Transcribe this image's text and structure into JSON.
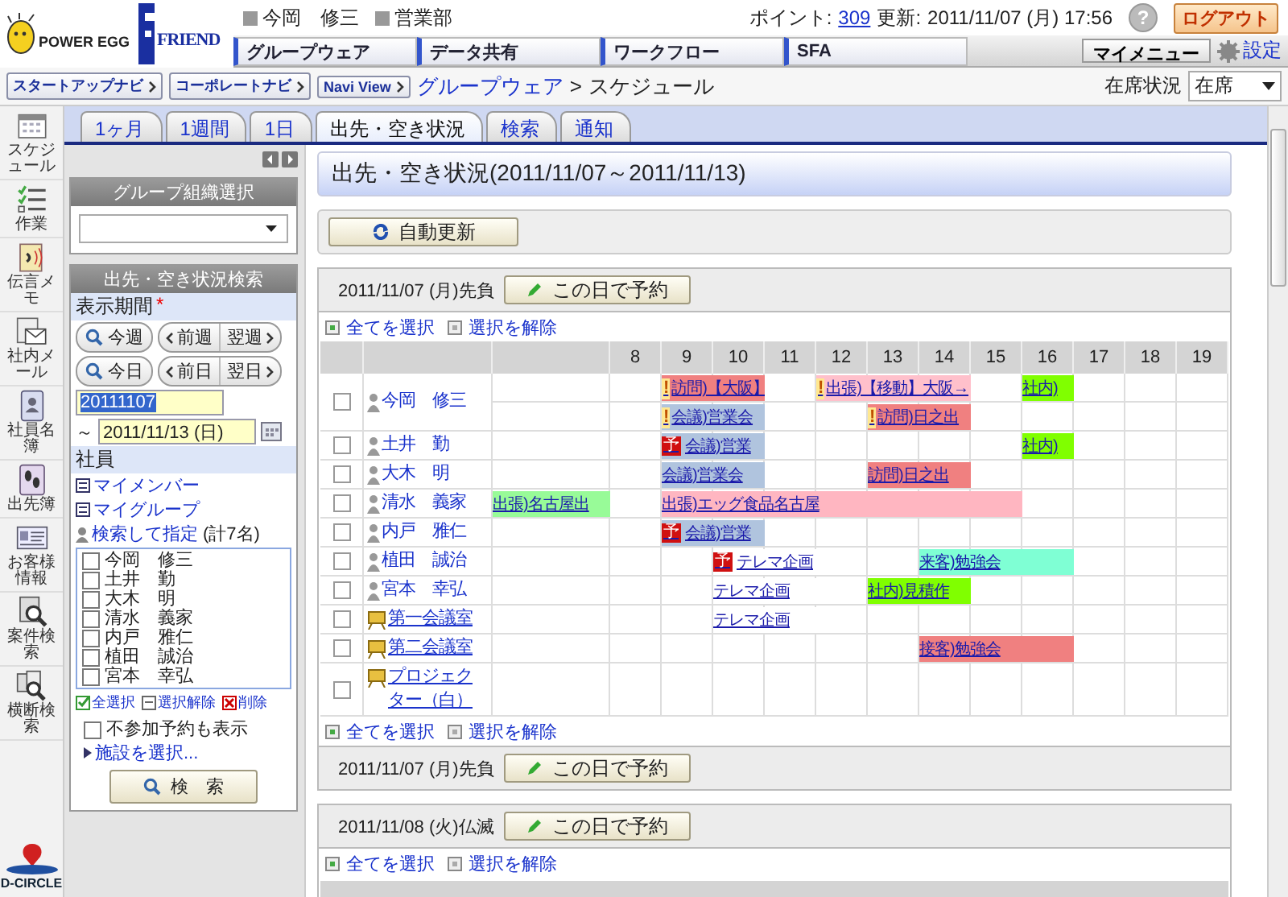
{
  "header": {
    "logo": {
      "product": "POWER EGG",
      "edition": "FRIEND"
    },
    "user": {
      "name": "今岡　修三",
      "department": "営業部"
    },
    "points_label": "ポイント:",
    "points": "309",
    "updated_label": "更新:",
    "updated": "2011/11/07 (月) 17:56",
    "help": "?",
    "logout": "ログアウト",
    "nav": [
      "グループウェア",
      "データ共有",
      "ワークフロー",
      "SFA"
    ],
    "my_menu": "マイメニュー",
    "settings": "設定"
  },
  "navi_buttons": [
    "スタートアップナビ",
    "コーポレートナビ",
    "Navi View"
  ],
  "breadcrumb": [
    "グループウェア",
    "スケジュール"
  ],
  "breadcrumb_separator": ">",
  "presence": {
    "label": "在席状況",
    "value": "在席"
  },
  "sidebar": [
    {
      "label": "スケジュール",
      "kind": "calendar"
    },
    {
      "label": "作業",
      "kind": "checklist"
    },
    {
      "label": "伝言メモ",
      "kind": "memo"
    },
    {
      "label": "社内メール",
      "kind": "mail"
    },
    {
      "label": "社員名簿",
      "kind": "contacts"
    },
    {
      "label": "出先簿",
      "kind": "footprints"
    },
    {
      "label": "お客様情報",
      "kind": "customer"
    },
    {
      "label": "案件検索",
      "kind": "search"
    },
    {
      "label": "横断検索",
      "kind": "multisearch"
    }
  ],
  "footer_logo": "D-CIRCLE",
  "tabs": [
    {
      "label": "1ヶ月",
      "selected": false
    },
    {
      "label": "1週間",
      "selected": false
    },
    {
      "label": "1日",
      "selected": false
    },
    {
      "label": "出先・空き状況",
      "selected": true
    },
    {
      "label": "検索",
      "selected": false
    },
    {
      "label": "通知",
      "selected": false
    }
  ],
  "group_select": {
    "title": "グループ組織選択"
  },
  "search_panel": {
    "title": "出先・空き状況検索",
    "period_label": "表示期間",
    "required_mark": "*",
    "week_buttons": [
      {
        "label": "今週",
        "kind": "search"
      },
      {
        "label": "前週",
        "kind": "prev"
      },
      {
        "label": "翌週",
        "kind": "next"
      }
    ],
    "day_buttons": [
      {
        "label": "今日",
        "kind": "search"
      },
      {
        "label": "前日",
        "kind": "prev"
      },
      {
        "label": "翌日",
        "kind": "next"
      }
    ],
    "from": "20111107",
    "tilde": "～",
    "to": "2011/11/13 (日)",
    "members_label": "社員",
    "links": [
      "マイメンバー",
      "マイグループ"
    ],
    "search_pick": "検索して指定",
    "count": "(計7名)",
    "members": [
      {
        "name": "今岡　修三",
        "checked": false
      },
      {
        "name": "土井　勤",
        "checked": false
      },
      {
        "name": "大木　明",
        "checked": false
      },
      {
        "name": "清水　義家",
        "checked": false
      },
      {
        "name": "内戸　雅仁",
        "checked": false
      },
      {
        "name": "植田　誠治",
        "checked": false
      },
      {
        "name": "宮本　幸弘",
        "checked": false
      }
    ],
    "actions": [
      {
        "label": "全選択",
        "kind": "check"
      },
      {
        "label": "選択解除",
        "kind": "uncheck"
      },
      {
        "label": "削除",
        "kind": "delete"
      }
    ],
    "show_declined": {
      "label": "不参加予約も表示",
      "checked": false
    },
    "facility_link": "施設を選択...",
    "search_button": "検　索"
  },
  "main": {
    "title": "出先・空き状況(2011/11/07～2011/11/13)",
    "refresh_button": "自動更新",
    "days": [
      {
        "date": "2011/11/07 (月)先負",
        "reserve_button": "この日で予約",
        "links_top": [
          "全てを選択",
          "選択を解除"
        ],
        "hours": [
          "8",
          "9",
          "10",
          "11",
          "12",
          "13",
          "14",
          "15",
          "16",
          "17",
          "18",
          "19"
        ],
        "rows": [
          {
            "name": "今岡　修三",
            "kind": "person",
            "checked": false,
            "events": [
              {
                "kind": "free"
              },
              {
                "kind": "free"
              },
              {
                "kind": "event",
                "label": "訪問)【大阪】",
                "color": "#f08080",
                "badge": {
                  "kind": "alert",
                  "text": "!"
                }
              },
              {
                "kind": "cont"
              },
              {
                "kind": "free"
              },
              {
                "kind": "event",
                "label": "出張)【移動】大阪→",
                "color": "#ffc0cb",
                "badge": {
                  "kind": "alert",
                  "text": "!"
                }
              },
              {
                "kind": "cont"
              },
              {
                "kind": "cont"
              },
              {
                "kind": "free"
              },
              {
                "kind": "event",
                "label": "社内)",
                "color": "#80ff00"
              }
            ],
            "more_events": [
              {
                "kind": "free"
              },
              {
                "kind": "free"
              },
              {
                "kind": "event",
                "label": "会議)営業会",
                "color": "#b0c4de",
                "badge": {
                  "kind": "alert",
                  "text": "!"
                }
              },
              {
                "kind": "cont"
              },
              {
                "kind": "free"
              },
              {
                "kind": "free"
              },
              {
                "kind": "event",
                "label": "訪問)日之出",
                "color": "#f08080",
                "badge": {
                  "kind": "alert",
                  "text": "!"
                }
              },
              {
                "kind": "cont"
              }
            ]
          },
          {
            "name": "土井　勤",
            "kind": "person",
            "checked": false,
            "events": [
              {
                "kind": "free"
              },
              {
                "kind": "free"
              },
              {
                "kind": "event",
                "label": "会議)営業",
                "color": "#b0c4de",
                "badge": {
                  "kind": "tentative",
                  "text": "予"
                }
              },
              {
                "kind": "cont"
              },
              {
                "kind": "free"
              },
              {
                "kind": "free"
              },
              {
                "kind": "free"
              },
              {
                "kind": "free"
              },
              {
                "kind": "free"
              },
              {
                "kind": "event",
                "label": "社内)",
                "color": "#80ff00"
              }
            ]
          },
          {
            "name": "大木　明",
            "kind": "person",
            "checked": false,
            "events": [
              {
                "kind": "free"
              },
              {
                "kind": "free"
              },
              {
                "kind": "event",
                "label": "会議)営業会",
                "color": "#b0c4de"
              },
              {
                "kind": "cont"
              },
              {
                "kind": "free"
              },
              {
                "kind": "free"
              },
              {
                "kind": "event",
                "label": "訪問)日之出",
                "color": "#f08080"
              },
              {
                "kind": "cont"
              }
            ]
          },
          {
            "name": "清水　義家",
            "kind": "person",
            "checked": false,
            "events": [
              {
                "kind": "event",
                "label": "出張)名古屋出",
                "color": "#98fb98"
              },
              {
                "kind": "free"
              },
              {
                "kind": "event",
                "label": "出張)エッグ食品名古屋",
                "color": "#ffb6c1"
              },
              {
                "kind": "cont"
              },
              {
                "kind": "cont"
              },
              {
                "kind": "cont"
              },
              {
                "kind": "cont"
              },
              {
                "kind": "cont"
              },
              {
                "kind": "cont"
              }
            ]
          },
          {
            "name": "内戸　雅仁",
            "kind": "person",
            "checked": false,
            "events": [
              {
                "kind": "free"
              },
              {
                "kind": "free"
              },
              {
                "kind": "event",
                "label": "会議)営業",
                "color": "#b0c4de",
                "badge": {
                  "kind": "tentative",
                  "text": "予"
                }
              },
              {
                "kind": "cont"
              }
            ]
          },
          {
            "name": "植田　誠治",
            "kind": "person",
            "checked": false,
            "events": [
              {
                "kind": "free"
              },
              {
                "kind": "free"
              },
              {
                "kind": "free"
              },
              {
                "kind": "event",
                "label": "テレマ企画",
                "color": "#ffffff",
                "badge": {
                  "kind": "tentative",
                  "text": "予"
                }
              },
              {
                "kind": "cont"
              },
              {
                "kind": "free"
              },
              {
                "kind": "free"
              },
              {
                "kind": "event",
                "label": "来客)勉強会",
                "color": "#7fffd4"
              },
              {
                "kind": "cont"
              },
              {
                "kind": "cont"
              }
            ]
          },
          {
            "name": "宮本　幸弘",
            "kind": "person",
            "checked": false,
            "events": [
              {
                "kind": "free"
              },
              {
                "kind": "free"
              },
              {
                "kind": "free"
              },
              {
                "kind": "event",
                "label": "テレマ企画",
                "color": "#ffffff"
              },
              {
                "kind": "cont"
              },
              {
                "kind": "free"
              },
              {
                "kind": "event",
                "label": "社内)見積作",
                "color": "#80ff00"
              },
              {
                "kind": "cont"
              }
            ]
          },
          {
            "name": "第一会議室",
            "kind": "room",
            "checked": false,
            "events": [
              {
                "kind": "free"
              },
              {
                "kind": "free"
              },
              {
                "kind": "free"
              },
              {
                "kind": "event",
                "label": "テレマ企画",
                "color": "#ffffff"
              },
              {
                "kind": "cont"
              }
            ]
          },
          {
            "name": "第二会議室",
            "kind": "room",
            "checked": false,
            "events": [
              {
                "kind": "free"
              },
              {
                "kind": "free"
              },
              {
                "kind": "free"
              },
              {
                "kind": "free"
              },
              {
                "kind": "free"
              },
              {
                "kind": "free"
              },
              {
                "kind": "free"
              },
              {
                "kind": "event",
                "label": "接客)勉強会",
                "color": "#f08080"
              },
              {
                "kind": "cont"
              },
              {
                "kind": "cont"
              }
            ]
          },
          {
            "name": "プロジェクター（白）",
            "kind": "room",
            "checked": false
          }
        ],
        "links_bottom": [
          "全てを選択",
          "選択を解除"
        ],
        "footer": {
          "date": "2011/11/07 (月)先負",
          "reserve_button": "この日で予約"
        }
      },
      {
        "date": "2011/11/08 (火)仏滅",
        "reserve_button": "この日で予約",
        "links_top": [
          "全てを選択",
          "選択を解除"
        ]
      }
    ]
  }
}
